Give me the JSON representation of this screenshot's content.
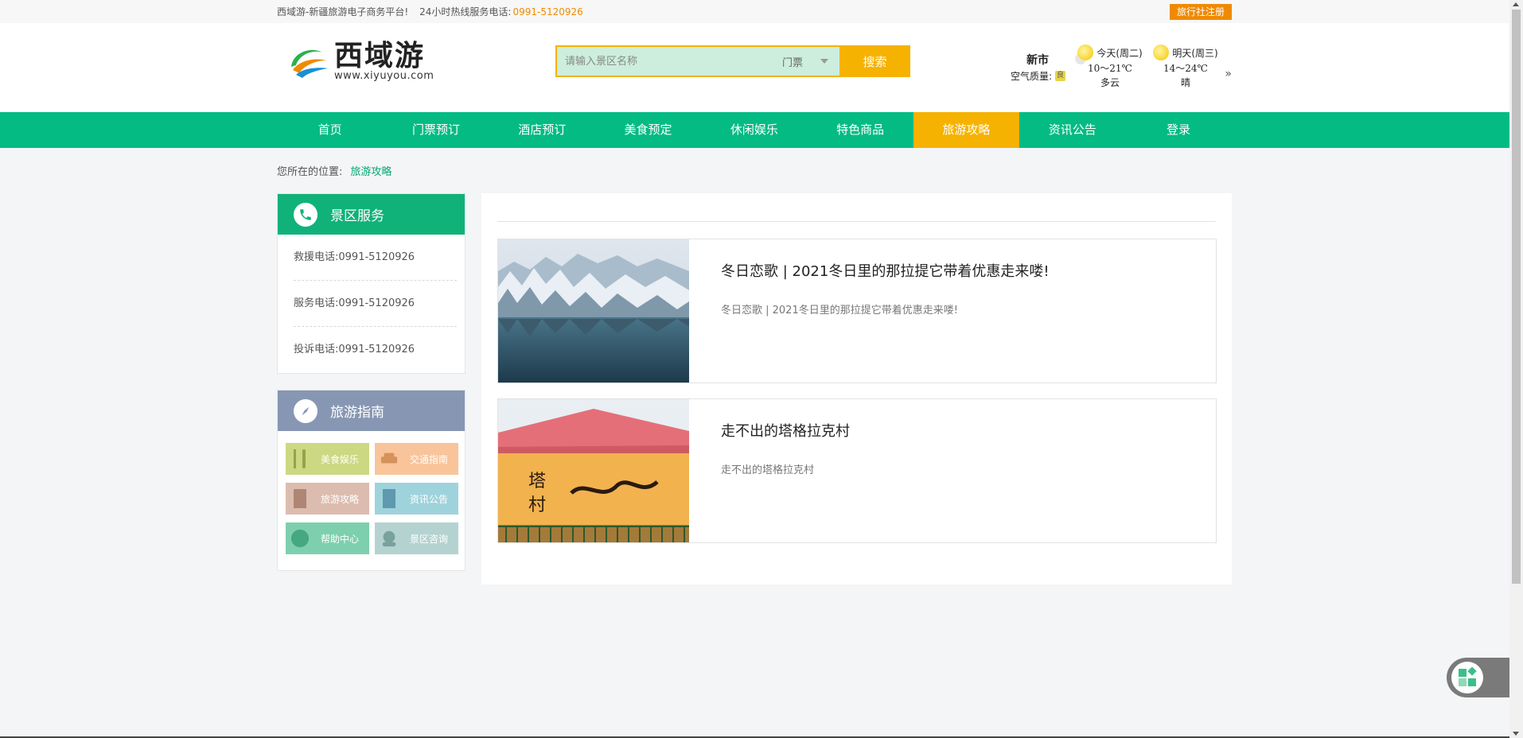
{
  "topbar": {
    "slogan": "西域游-新疆旅游电子商务平台!",
    "hotline_label": "24小时热线服务电话:",
    "hotline_number": "0991-5120926",
    "agency_register": "旅行社注册"
  },
  "logo": {
    "name_cn": "西域游",
    "domain": "www.xiyuyou.com"
  },
  "search": {
    "placeholder": "请输入景区名称",
    "category": "门票",
    "button": "搜索"
  },
  "weather": {
    "city": "新市",
    "air_quality_label": "空气质量:",
    "air_quality_value": "良",
    "today": {
      "label": "今天(周二)",
      "temp": "10～21℃",
      "condition": "多云"
    },
    "tomorrow": {
      "label": "明天(周三)",
      "temp": "14～24℃",
      "condition": "晴"
    },
    "more": "»"
  },
  "nav": {
    "items": [
      "首页",
      "门票预订",
      "酒店预订",
      "美食预定",
      "休闲娱乐",
      "特色商品",
      "旅游攻略",
      "资讯公告",
      "登录"
    ],
    "active": "旅游攻略"
  },
  "breadcrumb": {
    "label": "您所在的位置:",
    "current": "旅游攻略"
  },
  "service_panel": {
    "title": "景区服务",
    "items": [
      "救援电话:0991-5120926",
      "服务电话:0991-5120926",
      "投诉电话:0991-5120926"
    ]
  },
  "guide_panel": {
    "title": "旅游指南",
    "buttons": [
      "美食娱乐",
      "交通指南",
      "旅游攻略",
      "资讯公告",
      "帮助中心",
      "景区咨询"
    ]
  },
  "articles": [
    {
      "title": "冬日恋歌 | 2021冬日里的那拉提它带着优惠走来喽!",
      "summary": "冬日恋歌 | 2021冬日里的那拉提它带着优惠走来喽!"
    },
    {
      "title": "走不出的塔格拉克村",
      "summary": "走不出的塔格拉克村"
    }
  ],
  "colors": {
    "primary_green": "#03bb83",
    "accent_orange": "#f6b200",
    "hotline_orange": "#f08a00"
  }
}
